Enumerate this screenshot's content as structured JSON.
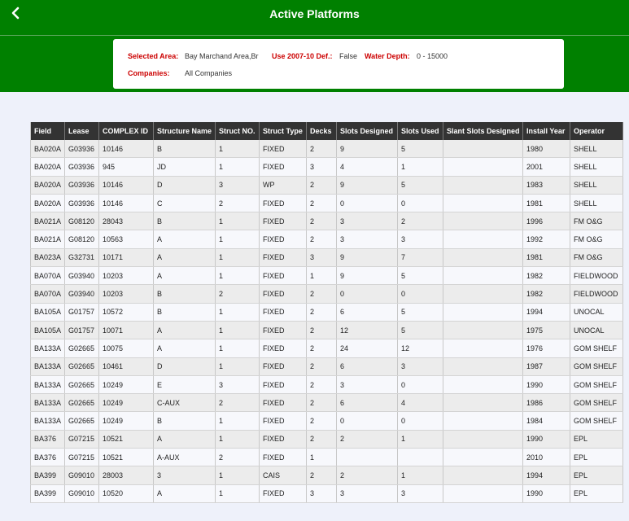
{
  "header": {
    "title": "Active Platforms",
    "back_icon": "chevron-left-icon"
  },
  "filters": {
    "selected_area_label": "Selected Area:",
    "selected_area_value": "Bay Marchand Area,Br",
    "use_label": "Use 2007-10 Def.:",
    "use_value": "False",
    "water_depth_label": "Water Depth:",
    "water_depth_value": "0 - 15000",
    "companies_label": "Companies:",
    "companies_value": "All Companies"
  },
  "colors": {
    "brand_green": "#008000",
    "label_red": "#cc0000",
    "header_dark": "#333333"
  },
  "table": {
    "columns": [
      "Field",
      "Lease",
      "COMPLEX ID",
      "Structure Name",
      "Struct NO.",
      "Struct Type",
      "Decks",
      "Slots Designed",
      "Slots Used",
      "Slant Slots Designed",
      "Install Year",
      "Operator"
    ],
    "rows": [
      [
        "BA020A",
        "G03936",
        "10146",
        "B",
        "1",
        "FIXED",
        "2",
        "9",
        "5",
        "",
        "1980",
        "SHELL"
      ],
      [
        "BA020A",
        "G03936",
        "945",
        "JD",
        "1",
        "FIXED",
        "3",
        "4",
        "1",
        "",
        "2001",
        "SHELL"
      ],
      [
        "BA020A",
        "G03936",
        "10146",
        "D",
        "3",
        "WP",
        "2",
        "9",
        "5",
        "",
        "1983",
        "SHELL"
      ],
      [
        "BA020A",
        "G03936",
        "10146",
        "C",
        "2",
        "FIXED",
        "2",
        "0",
        "0",
        "",
        "1981",
        "SHELL"
      ],
      [
        "BA021A",
        "G08120",
        "28043",
        "B",
        "1",
        "FIXED",
        "2",
        "3",
        "2",
        "",
        "1996",
        "FM O&G"
      ],
      [
        "BA021A",
        "G08120",
        "10563",
        "A",
        "1",
        "FIXED",
        "2",
        "3",
        "3",
        "",
        "1992",
        "FM O&G"
      ],
      [
        "BA023A",
        "G32731",
        "10171",
        "A",
        "1",
        "FIXED",
        "3",
        "9",
        "7",
        "",
        "1981",
        "FM O&G"
      ],
      [
        "BA070A",
        "G03940",
        "10203",
        "A",
        "1",
        "FIXED",
        "1",
        "9",
        "5",
        "",
        "1982",
        "FIELDWOOD"
      ],
      [
        "BA070A",
        "G03940",
        "10203",
        "B",
        "2",
        "FIXED",
        "2",
        "0",
        "0",
        "",
        "1982",
        "FIELDWOOD"
      ],
      [
        "BA105A",
        "G01757",
        "10572",
        "B",
        "1",
        "FIXED",
        "2",
        "6",
        "5",
        "",
        "1994",
        "UNOCAL"
      ],
      [
        "BA105A",
        "G01757",
        "10071",
        "A",
        "1",
        "FIXED",
        "2",
        "12",
        "5",
        "",
        "1975",
        "UNOCAL"
      ],
      [
        "BA133A",
        "G02665",
        "10075",
        "A",
        "1",
        "FIXED",
        "2",
        "24",
        "12",
        "",
        "1976",
        "GOM SHELF"
      ],
      [
        "BA133A",
        "G02665",
        "10461",
        "D",
        "1",
        "FIXED",
        "2",
        "6",
        "3",
        "",
        "1987",
        "GOM SHELF"
      ],
      [
        "BA133A",
        "G02665",
        "10249",
        "E",
        "3",
        "FIXED",
        "2",
        "3",
        "0",
        "",
        "1990",
        "GOM SHELF"
      ],
      [
        "BA133A",
        "G02665",
        "10249",
        "C-AUX",
        "2",
        "FIXED",
        "2",
        "6",
        "4",
        "",
        "1986",
        "GOM SHELF"
      ],
      [
        "BA133A",
        "G02665",
        "10249",
        "B",
        "1",
        "FIXED",
        "2",
        "0",
        "0",
        "",
        "1984",
        "GOM SHELF"
      ],
      [
        "BA376",
        "G07215",
        "10521",
        "A",
        "1",
        "FIXED",
        "2",
        "2",
        "1",
        "",
        "1990",
        "EPL"
      ],
      [
        "BA376",
        "G07215",
        "10521",
        "A-AUX",
        "2",
        "FIXED",
        "1",
        "",
        "",
        "",
        "2010",
        "EPL"
      ],
      [
        "BA399",
        "G09010",
        "28003",
        "3",
        "1",
        "CAIS",
        "2",
        "2",
        "1",
        "",
        "1994",
        "EPL"
      ],
      [
        "BA399",
        "G09010",
        "10520",
        "A",
        "1",
        "FIXED",
        "3",
        "3",
        "3",
        "",
        "1990",
        "EPL"
      ]
    ]
  }
}
